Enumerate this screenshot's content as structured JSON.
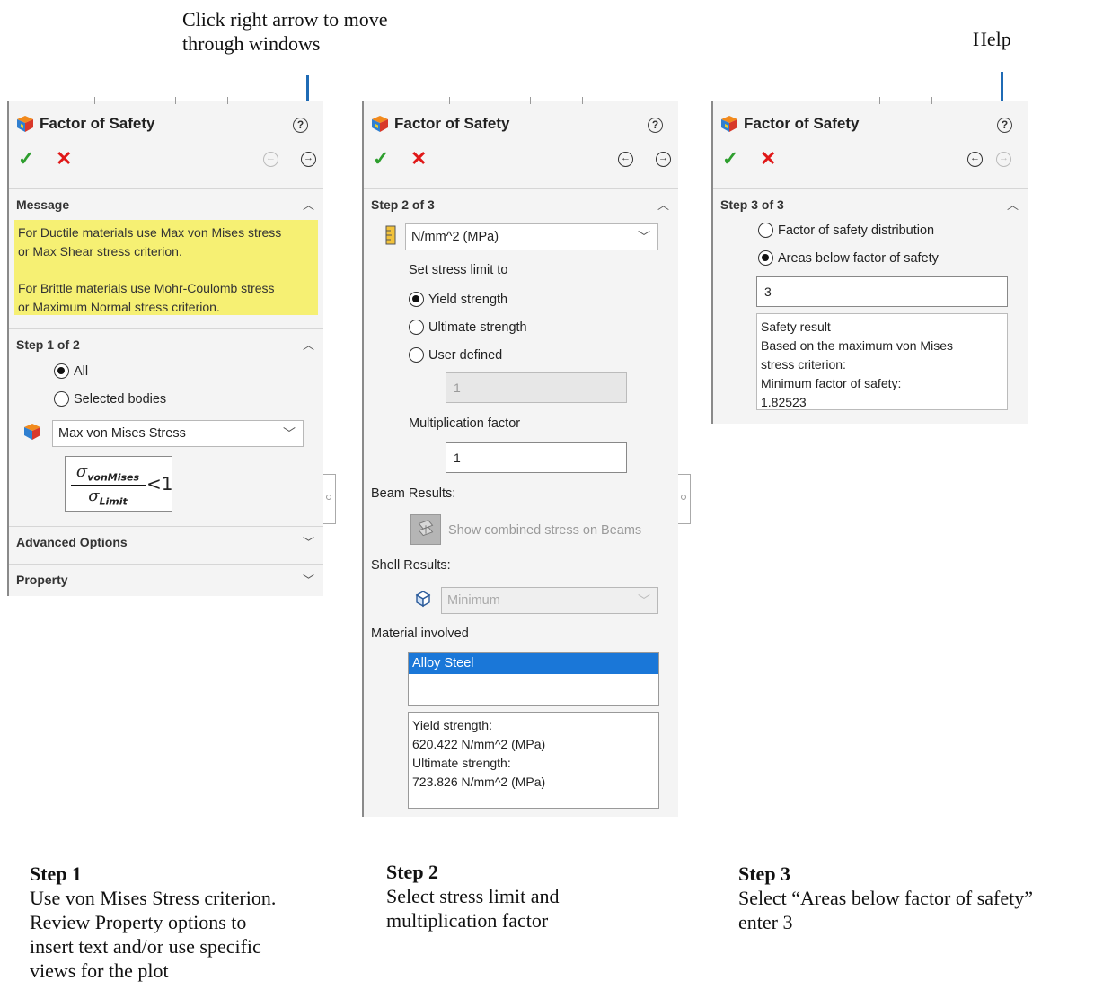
{
  "annotations": {
    "top_left": [
      "Click right arrow to move",
      "through windows"
    ],
    "top_right": "Help"
  },
  "colors": {
    "accent_arrow": "#1f6bb5",
    "message_bg": "#f6f073",
    "selection_bg": "#1a77d8",
    "ok": "#2e9e2e",
    "cancel": "#e01818"
  },
  "panel1": {
    "title": "Factor of Safety",
    "message_header": "Message",
    "message_lines": [
      "For Ductile materials use Max von Mises stress",
      "or Max Shear stress criterion.",
      "",
      "For Brittle materials use Mohr-Coulomb stress",
      "or Maximum Normal stress criterion."
    ],
    "step_header": "Step 1 of 2",
    "radio_all": "All",
    "radio_selected": "Selected bodies",
    "criterion": "Max von Mises Stress",
    "formula_top": "σ",
    "formula_top_sub": "vonMises",
    "formula_bottom": "σ",
    "formula_bottom_sub": "Limit",
    "formula_rhs": "<1",
    "advanced_header": "Advanced Options",
    "property_header": "Property"
  },
  "panel2": {
    "title": "Factor of Safety",
    "step_header": "Step 2 of 3",
    "units": "N/mm^2 (MPa)",
    "set_limit_label": "Set stress limit to",
    "radio_yield": "Yield strength",
    "radio_ultimate": "Ultimate strength",
    "radio_user": "User defined",
    "user_value": "1",
    "mult_label": "Multiplication factor",
    "mult_value": "1",
    "beam_label": "Beam Results:",
    "beam_btn": "Show combined stress on Beams",
    "shell_label": "Shell Results:",
    "shell_value": "Minimum",
    "material_label": "Material involved",
    "material_selected": "Alloy Steel",
    "props_lines": [
      "Yield strength:",
      "620.422 N/mm^2 (MPa)",
      "Ultimate strength:",
      "723.826 N/mm^2 (MPa)"
    ]
  },
  "panel3": {
    "title": "Factor of Safety",
    "step_header": "Step 3 of 3",
    "radio_distribution": "Factor of safety distribution",
    "radio_areas": "Areas below factor of safety",
    "areas_value": "3",
    "result_lines": [
      "Safety result",
      "Based on the maximum von Mises",
      "stress criterion:",
      "Minimum factor of safety:",
      "1.82523"
    ]
  },
  "captions": [
    {
      "title": "Step 1",
      "lines": [
        "Use von Mises Stress criterion.",
        "Review Property options to",
        "insert text and/or use specific",
        "views for the plot"
      ]
    },
    {
      "title": "Step 2",
      "lines": [
        "Select stress limit and",
        "multiplication factor"
      ]
    },
    {
      "title": "Step 3",
      "lines": [
        "Select “Areas below factor of safety”",
        "enter 3"
      ]
    }
  ]
}
